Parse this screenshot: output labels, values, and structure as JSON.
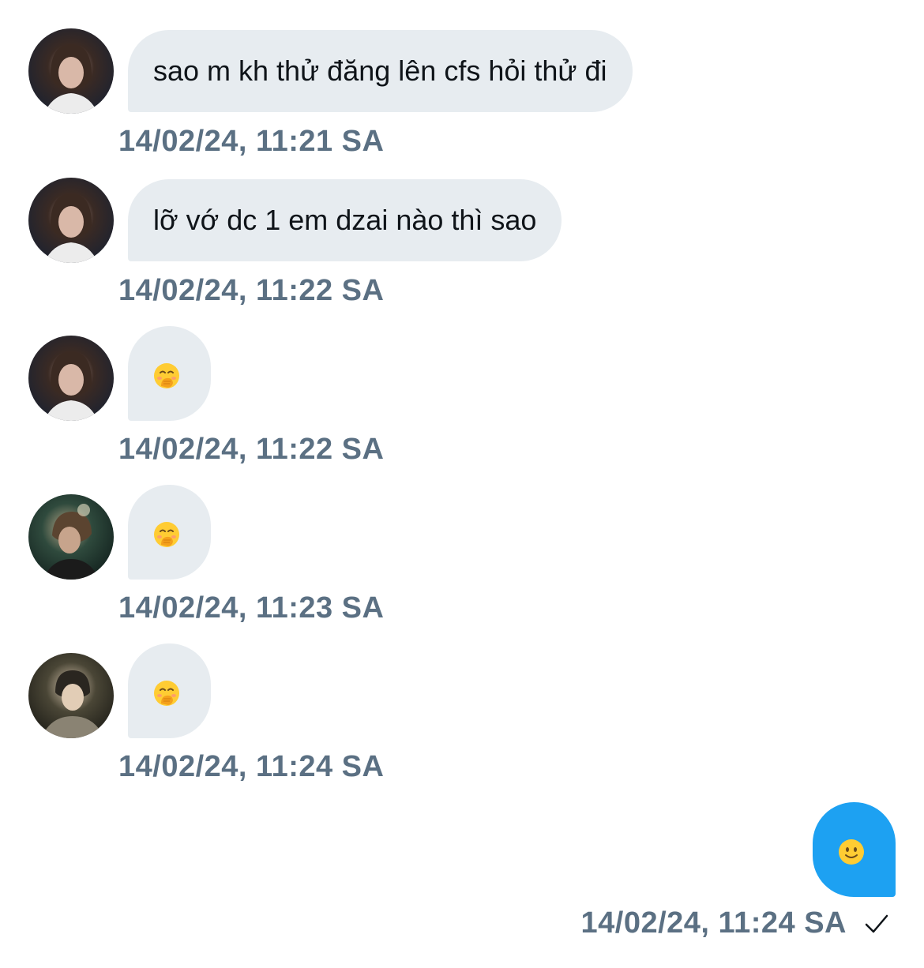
{
  "messages": [
    {
      "avatar_icon": "avatar-user-1-icon",
      "text": "sao m kh thử đăng lên cfs hỏi thử đi",
      "time": "14/02/24, 11:21 SA"
    },
    {
      "avatar_icon": "avatar-user-1-icon",
      "text": "lỡ vớ dc 1 em dzai nào thì sao",
      "time": "14/02/24, 11:22 SA"
    },
    {
      "avatar_icon": "avatar-user-1-icon",
      "emoji_icon": "hand-over-mouth-emoji-icon",
      "time": "14/02/24, 11:22 SA"
    },
    {
      "avatar_icon": "avatar-user-2-icon",
      "emoji_icon": "hand-over-mouth-emoji-icon",
      "time": "14/02/24, 11:23 SA"
    },
    {
      "avatar_icon": "avatar-user-3-icon",
      "emoji_icon": "hand-over-mouth-emoji-icon",
      "time": "14/02/24, 11:24 SA"
    }
  ],
  "outgoing": {
    "emoji_icon": "slightly-smiling-face-emoji-icon",
    "time": "14/02/24, 11:24 SA",
    "status_icon": "check-icon"
  },
  "colors": {
    "incoming_bubble": "#e7ecf0",
    "outgoing_bubble": "#1da1f2",
    "timestamp": "#5b7083",
    "text": "#0f1419"
  }
}
